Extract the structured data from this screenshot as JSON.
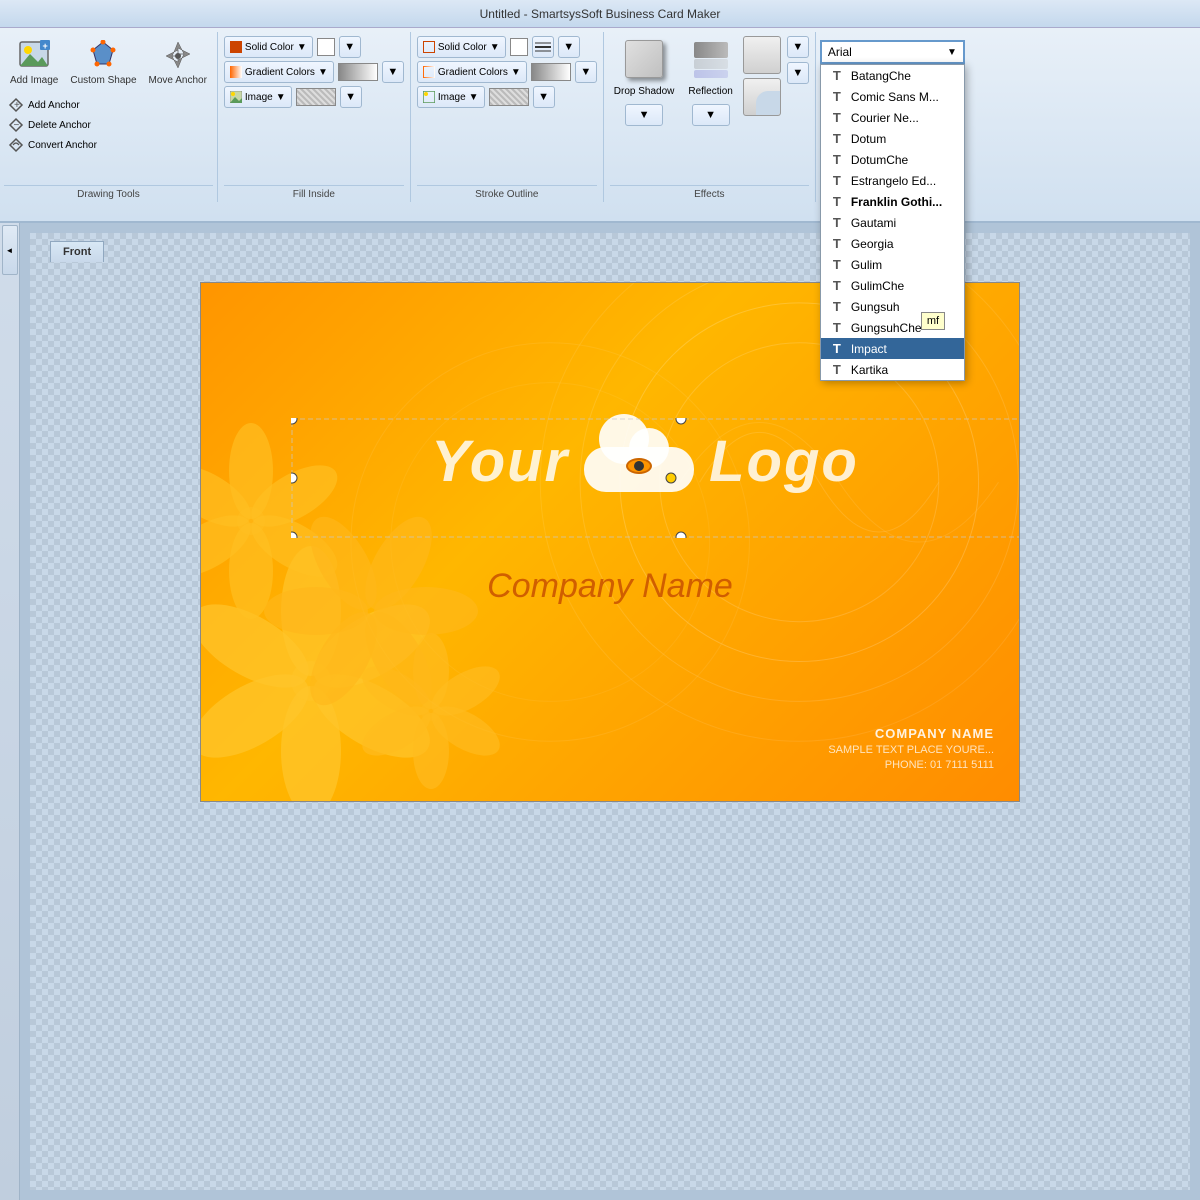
{
  "app": {
    "title": "Untitled - SmartsysSoft Business Card Maker"
  },
  "ribbon": {
    "drawing_tools_label": "Drawing Tools",
    "fill_inside_label": "Fill Inside",
    "stroke_outline_label": "Stroke Outline",
    "effects_label": "Effects",
    "add_image_label": "Add Image",
    "custom_shape_label": "Custom Shape",
    "move_anchor_label": "Move Anchor",
    "add_anchor_label": "Add Anchor",
    "delete_anchor_label": "Delete Anchor",
    "convert_anchor_label": "Convert Anchor",
    "solid_color_fill": "Solid Color",
    "gradient_colors_fill": "Gradient Colors",
    "image_fill": "Image",
    "solid_color_stroke": "Solid Color",
    "gradient_colors_stroke": "Gradient Colors",
    "image_stroke": "Image",
    "drop_shadow_label": "Drop Shadow",
    "reflection_label": "Reflection"
  },
  "font": {
    "current": "Arial",
    "list": [
      {
        "name": "BatangChe",
        "bold": false
      },
      {
        "name": "Comic Sans M...",
        "bold": false
      },
      {
        "name": "Courier Ne...",
        "bold": false
      },
      {
        "name": "Dotum",
        "bold": false
      },
      {
        "name": "DotumChe",
        "bold": false
      },
      {
        "name": "Estrangelo Ed...",
        "bold": false
      },
      {
        "name": "Franklin Gothi...",
        "bold": true
      },
      {
        "name": "Gautami",
        "bold": false
      },
      {
        "name": "Georgia",
        "bold": false
      },
      {
        "name": "Gulim",
        "bold": false
      },
      {
        "name": "GulimChe",
        "bold": false
      },
      {
        "name": "Gungsuh",
        "bold": false
      },
      {
        "name": "GungsuhChe",
        "bold": false
      },
      {
        "name": "Impact",
        "bold": false,
        "highlighted": true
      },
      {
        "name": "Kartika",
        "bold": false
      }
    ]
  },
  "canvas": {
    "tab": "Front"
  },
  "business_card": {
    "logo_text_left": "Your",
    "logo_text_right": "Logo",
    "company_name": "Company Name",
    "info_line1": "COMPANY NAME",
    "info_line2": "SAMPLE TEXT PLACE YOURE...",
    "info_line3": "PHONE: 01 7111 5111"
  },
  "tooltip": {
    "text": "mf"
  }
}
